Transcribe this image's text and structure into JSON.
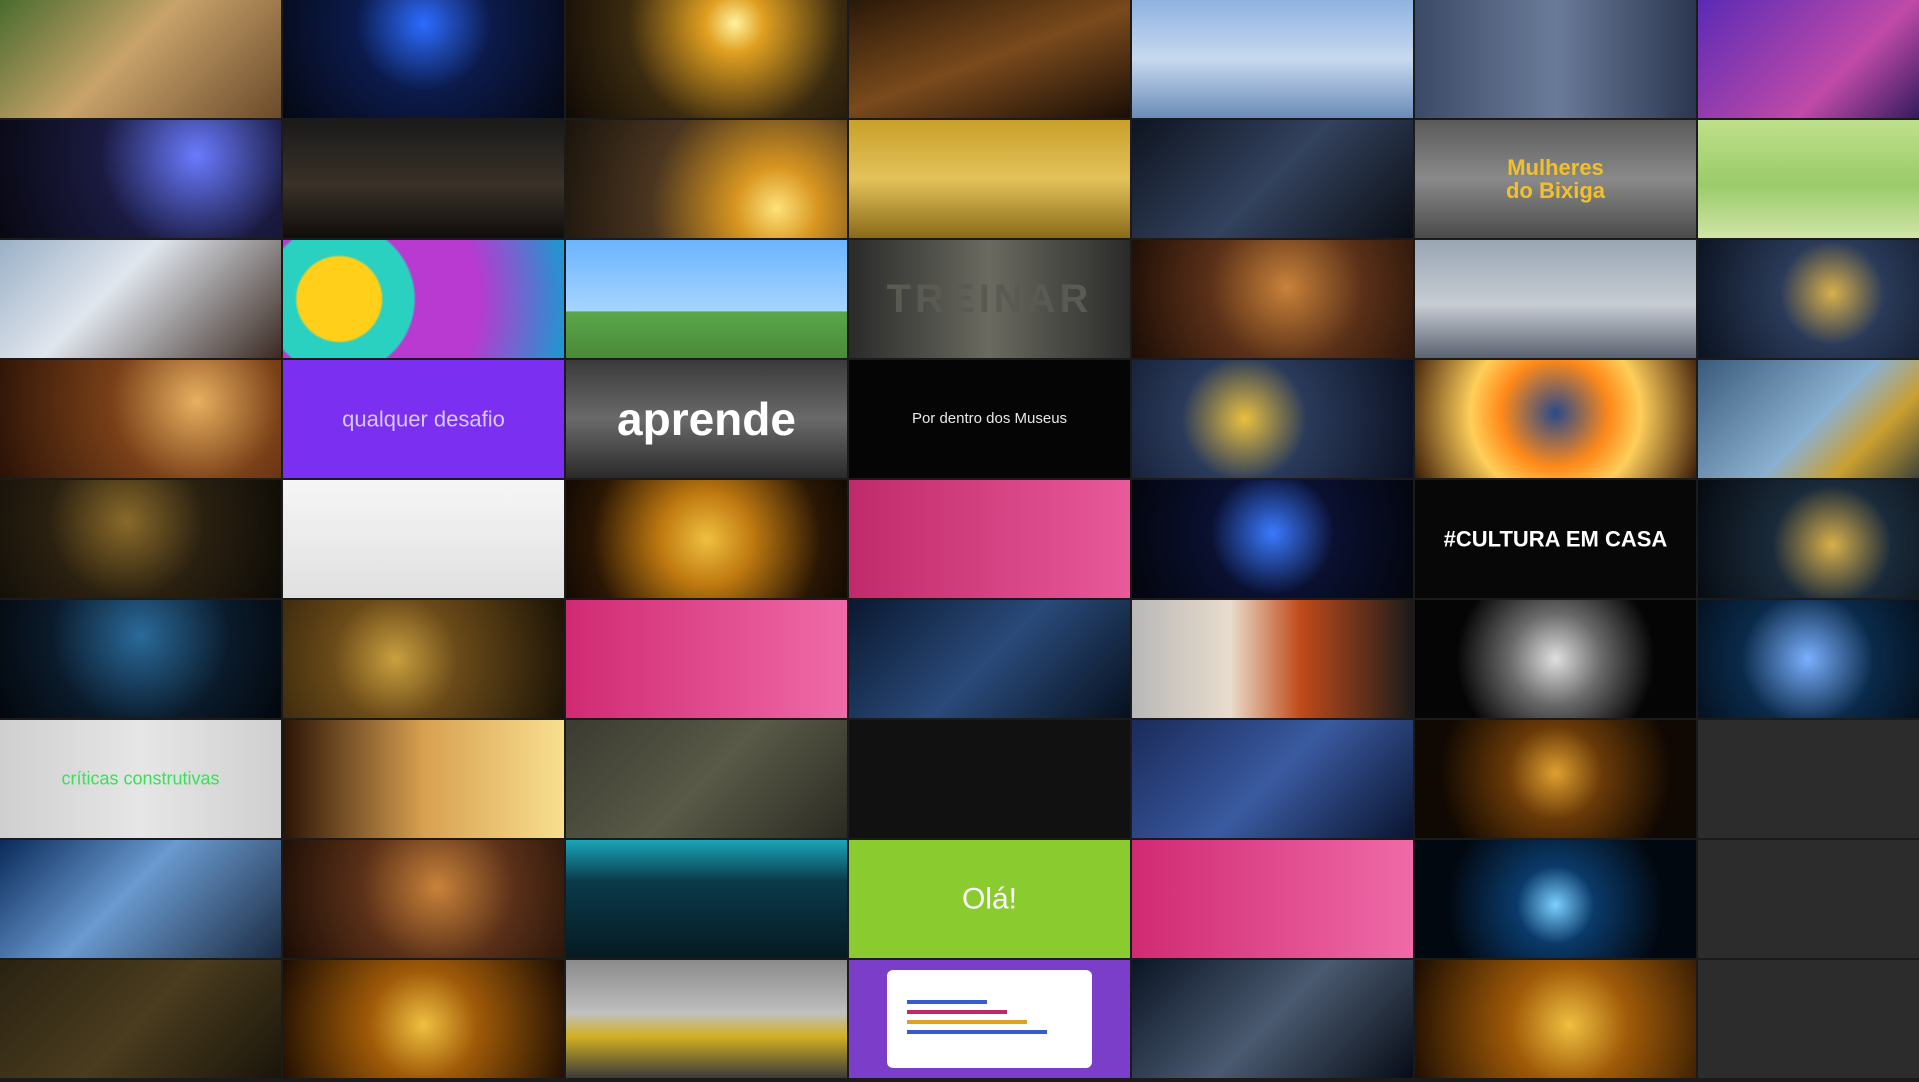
{
  "gallery": {
    "tiles": [
      {
        "caption": "",
        "bg": "linear-gradient(135deg,#4a6b2e 0%,#c9a36a 45%,#6b4a2a 100%)"
      },
      {
        "caption": "",
        "bg": "radial-gradient(circle at 50% 20%,#2d6cff 0%,#0b1a4a 40%,#050812 100%)"
      },
      {
        "caption": "",
        "bg": "radial-gradient(circle at 60% 20%,#fff3a0 0%,#e0a020 15%,#3a2a10 55%,#100a05 100%)"
      },
      {
        "caption": "",
        "bg": "linear-gradient(160deg,#2a1808 0%,#7a4a1c 50%,#1a0e06 100%)"
      },
      {
        "caption": "",
        "bg": "linear-gradient(180deg,#8fb3e0 0%,#c7d9ef 50%,#6a8cb8 100%)"
      },
      {
        "caption": "",
        "bg": "linear-gradient(90deg,#3b4a66 0%,#6a7b99 50%,#2b3650 100%)"
      },
      {
        "caption": "",
        "bg": "linear-gradient(135deg,#5a2ab5 0%,#c04aa8 60%,#1a1250 100%)"
      },
      {
        "caption": "",
        "bg": "radial-gradient(circle at 70% 30%,#6a7bff 0%,#1a1a40 45%,#080812 100%)"
      },
      {
        "caption": "",
        "bg": "linear-gradient(180deg,#1a1a1a 0%,#3a3128 55%,#0f0d0b 100%)"
      },
      {
        "caption": "",
        "bg": "radial-gradient(circle at 75% 75%,#ffe27a 0%,#d89620 18%,#4a3520 55%,#1a140c 100%)"
      },
      {
        "caption": "",
        "bg": "linear-gradient(180deg,#c9a02a 0%,#e3c25a 50%,#8a6a18 100%)"
      },
      {
        "caption": "",
        "bg": "linear-gradient(135deg,#0e1420 0%,#33425e 50%,#0a0d14 100%)"
      },
      {
        "caption": "Mulheres\ndo Bixiga",
        "bg": "linear-gradient(180deg,#5a5a5a 0%,#8a8a8a 50%,#4a4a4a 100%)",
        "color": "#f2c02b",
        "size": 22,
        "weight": 700
      },
      {
        "caption": "",
        "bg": "linear-gradient(180deg,#bfe08a 0%,#9acb6a 55%,#cfe5a8 100%)"
      },
      {
        "caption": "",
        "bg": "linear-gradient(135deg,#9bb0c6 0%,#e0e6ee 40%,#3a2a22 100%)"
      },
      {
        "caption": "",
        "bg": "radial-gradient(circle at 20% 50%,#ffcf1a 0%,#ffcf1a 18%,#2ad0c0 19%,#2ad0c0 32%,#b83ad0 33%,#b83ad0 60%,#1a9ad0 100%)"
      },
      {
        "caption": "",
        "bg": "linear-gradient(180deg,#6ab4ff 0%,#a6d4ff 60%,#5aa64a 61%,#4a8a3a 100%)"
      },
      {
        "caption": "TREINAR",
        "bg": "linear-gradient(90deg,#2a2a2a 0%,#6a6a60 50%,#2a2a2a 100%)",
        "color": "#5a5a52",
        "size": 40,
        "weight": 700
      },
      {
        "caption": "",
        "bg": "radial-gradient(circle at 55% 40%,#c9823a 0%,#5a3018 45%,#1a0c05 100%)"
      },
      {
        "caption": "",
        "bg": "linear-gradient(180deg,#9aa6b4 0%,#c7ccd3 55%,#5a6270 100%)"
      },
      {
        "caption": "",
        "bg": "radial-gradient(circle at 55% 45%,#d8b04a 0%,#2a3a58 35%,#0b1220 100%)"
      },
      {
        "caption": "",
        "bg": "radial-gradient(circle at 70% 35%,#e8b060 0%,#7a4018 40%,#2a1206 100%)"
      },
      {
        "caption": "qualquer desafio",
        "bg": "#7b2ff0",
        "color": "#d9c8ff",
        "size": 22,
        "weight": 400
      },
      {
        "caption": "aprende",
        "bg": "linear-gradient(180deg,#3a3a3a 0%,#6a6a6a 50%,#2a2a2a 100%)",
        "color": "#ffffff",
        "size": 46,
        "weight": 700
      },
      {
        "caption": "Por dentro dos Museus",
        "bg": "#050505",
        "color": "#e8e8e8",
        "size": 15,
        "weight": 400
      },
      {
        "caption": "",
        "bg": "radial-gradient(circle at 40% 50%,#e8c040 0%,#2a3a5a 35%,#0a1020 100%)"
      },
      {
        "caption": "",
        "bg": "radial-gradient(circle at 50% 45%,#2a4a8a 0%,#ff8a1a 35%,#ffcf5a 55%,#3a1a08 100%)"
      },
      {
        "caption": "",
        "bg": "linear-gradient(135deg,#3a5a7a 0%,#8ab0d0 50%,#caa030 70%,#1a2a3a 100%)"
      },
      {
        "caption": "",
        "bg": "radial-gradient(circle at 45% 35%,#8a6a2a 0%,#2a2010 45%,#0c0a06 100%)"
      },
      {
        "caption": "",
        "bg": "linear-gradient(180deg,#f6f6f6 0%,#e0e0e0 100%)"
      },
      {
        "caption": "",
        "bg": "radial-gradient(circle at 50% 50%,#f0c040 0%,#c07a10 30%,#2a1604 75%,#120a02 100%)"
      },
      {
        "caption": "",
        "bg": "linear-gradient(90deg,#c02a6a 0%,#e85a9a 100%)"
      },
      {
        "caption": "",
        "bg": "radial-gradient(circle at 50% 45%,#3a7aff 0%,#0a1030 40%,#03050c 100%)"
      },
      {
        "caption": "#CULTURA EM CASA",
        "bg": "#070707",
        "color": "#ffffff",
        "size": 22,
        "weight": 700
      },
      {
        "caption": "",
        "bg": "radial-gradient(circle at 55% 55%,#d8b04a 0%,#1a2a3a 40%,#060a10 100%)"
      },
      {
        "caption": "",
        "bg": "radial-gradient(circle at 50% 30%,#2a6a9a 0%,#0a1a2a 55%,#03070c 100%)"
      },
      {
        "caption": "",
        "bg": "radial-gradient(circle at 40% 50%,#caa040 0%,#6a4a18 35%,#1a1206 100%)"
      },
      {
        "caption": "",
        "bg": "linear-gradient(90deg,#d02a72 0%,#f06aa8 100%)"
      },
      {
        "caption": "",
        "bg": "linear-gradient(135deg,#0a1830 0%,#2a4a7a 50%,#06101e 100%)"
      },
      {
        "caption": "",
        "bg": "linear-gradient(90deg,#b8b8b8 0%,#e8dccc 35%,#c04a1a 60%,#1a1a1a 100%)"
      },
      {
        "caption": "",
        "bg": "radial-gradient(circle at 50% 50%,#e0e0e0 0%,#6a6a6a 30%,#050505 65%)"
      },
      {
        "caption": "",
        "bg": "radial-gradient(circle at 45% 50%,#7ab0ff 0%,#0a2a4a 45%,#020810 100%)"
      },
      {
        "caption": "críticas construtivas",
        "bg": "linear-gradient(90deg,#cfcfcf 0%,#e6e6e6 50%,#cfcfcf 100%)",
        "color": "#39e05a",
        "size": 18,
        "weight": 400
      },
      {
        "caption": "",
        "bg": "linear-gradient(90deg,#2a1206 0%,#d8a050 50%,#f8e090 100%)"
      },
      {
        "caption": "",
        "bg": "linear-gradient(135deg,#3a3a30 0%,#5a5a48 50%,#2a2a22 100%)"
      },
      {
        "caption": "",
        "bg": "#111111"
      },
      {
        "caption": "",
        "bg": "linear-gradient(135deg,#1a2a5a 0%,#3a5aa0 50%,#0a1430 100%)"
      },
      {
        "caption": "",
        "bg": "radial-gradient(circle at 50% 45%,#e0a030 0%,#6a3a08 30%,#100802 75%)"
      },
      {
        "caption": "",
        "bg": "#2c2c2c",
        "empty": true
      },
      {
        "caption": "",
        "bg": "linear-gradient(135deg,#0a2a5a 0%,#6a9ad0 45%,#1a2a40 100%)"
      },
      {
        "caption": "",
        "bg": "radial-gradient(circle at 55% 40%,#c9823a 0%,#5a3018 45%,#1a0c05 100%)"
      },
      {
        "caption": "",
        "bg": "linear-gradient(180deg,#1aa6b8 0%,#0a3a4a 35%,#051a22 100%)"
      },
      {
        "caption": "Olá!",
        "bg": "#8acb30",
        "color": "#ffffff",
        "size": 30,
        "weight": 400
      },
      {
        "caption": "",
        "bg": "linear-gradient(90deg,#d02a72 0%,#f06aa8 100%)"
      },
      {
        "caption": "",
        "bg": "radial-gradient(circle at 50% 55%,#7ad0ff 0%,#0a3a6a 25%,#020810 70%)"
      },
      {
        "caption": "",
        "bg": "#2c2c2c",
        "empty": true
      },
      {
        "caption": "",
        "bg": "linear-gradient(135deg,#2a2212 0%,#4a3c1e 50%,#1a150a 100%)"
      },
      {
        "caption": "",
        "bg": "radial-gradient(circle at 50% 55%,#f0c040 0%,#a05a08 35%,#1a0c02 100%)"
      },
      {
        "caption": "",
        "bg": "linear-gradient(180deg,#8a8a8a 0%,#c0c0c0 45%,#d0b020 65%,#3a3a3a 100%)"
      },
      {
        "caption": "",
        "bg": "#7b3ec8"
      },
      {
        "caption": "",
        "bg": "linear-gradient(135deg,#0a1424 0%,#4a5a70 50%,#070c16 100%)"
      },
      {
        "caption": "",
        "bg": "radial-gradient(circle at 55% 55%,#f0c040 0%,#a05a08 35%,#1a0c02 100%)"
      },
      {
        "caption": "",
        "bg": "#2c2c2c",
        "empty": true
      }
    ]
  }
}
